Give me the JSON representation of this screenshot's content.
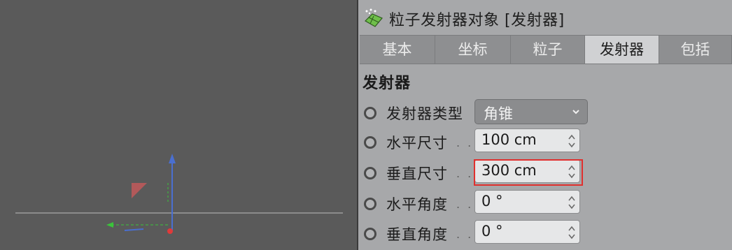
{
  "viewport": {
    "axis_colors": {
      "y": "#4a6fd0",
      "x": "#e03a3a",
      "z": "#3bc43b"
    }
  },
  "panel": {
    "title": "粒子发射器对象 [发射器]",
    "tabs": [
      {
        "label": "基本",
        "active": false
      },
      {
        "label": "坐标",
        "active": false
      },
      {
        "label": "粒子",
        "active": false
      },
      {
        "label": "发射器",
        "active": true
      },
      {
        "label": "包括",
        "active": false
      }
    ],
    "section_title": "发射器",
    "properties": [
      {
        "label": "发射器类型",
        "value": "角锥",
        "kind": "dropdown"
      },
      {
        "label": "水平尺寸",
        "value": "100 cm",
        "kind": "number"
      },
      {
        "label": "垂直尺寸",
        "value": "300 cm",
        "kind": "number",
        "highlighted": true
      },
      {
        "label": "水平角度",
        "value": "0 °",
        "kind": "number"
      },
      {
        "label": "垂直角度",
        "value": "0 °",
        "kind": "number"
      }
    ],
    "ellipsis": ". ."
  },
  "colors": {
    "highlight": "#e0302e"
  }
}
